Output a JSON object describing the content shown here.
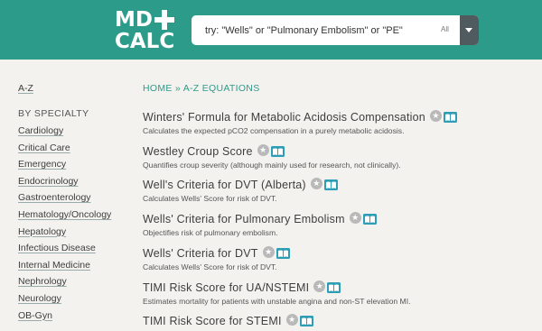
{
  "header": {
    "logo_line1": "MD",
    "logo_line2": "CALC",
    "search_placeholder": "try: \"Wells\" or \"Pulmonary Embolism\" or \"PE\"",
    "search_scope": "All"
  },
  "sidebar": {
    "az_link": "A-Z",
    "heading": "BY SPECIALTY",
    "items": [
      "Cardiology",
      "Critical Care",
      "Emergency",
      "Endocrinology",
      "Gastroenterology",
      "Hematology/Oncology",
      "Hepatology",
      "Infectious Disease",
      "Internal Medicine",
      "Nephrology",
      "Neurology",
      "OB-Gyn"
    ]
  },
  "breadcrumb": {
    "home": "HOME",
    "separator": "»",
    "current": "A-Z EQUATIONS"
  },
  "equations": [
    {
      "title": "Winters' Formula for Metabolic Acidosis Compensation",
      "desc": "Calculates the expected pCO2 compensation in a purely metabolic acidosis."
    },
    {
      "title": "Westley Croup Score",
      "desc": "Quantifies croup severity (although mainly used for research, not clinically)."
    },
    {
      "title": "Well's Criteria for DVT (Alberta)",
      "desc": "Calculates Wells' Score for risk of DVT."
    },
    {
      "title": "Wells' Criteria for Pulmonary Embolism",
      "desc": "Objectifies risk of pulmonary embolism."
    },
    {
      "title": "Wells' Criteria for DVT",
      "desc": "Calculates Wells' Score for risk of DVT."
    },
    {
      "title": "TIMI Risk Score for UA/NSTEMI",
      "desc": "Estimates mortality for patients with unstable angina and non-ST elevation MI."
    },
    {
      "title": "TIMI Risk Score for STEMI",
      "desc": ""
    }
  ],
  "icons": {
    "star": "star-icon",
    "book": "book-icon"
  },
  "colors": {
    "brand_teal": "#2d9b8a",
    "background": "#f4f2ef",
    "dropdown": "#4f5b5e",
    "star_badge": "#b9b9b9",
    "book_badge": "#2e9db6"
  }
}
